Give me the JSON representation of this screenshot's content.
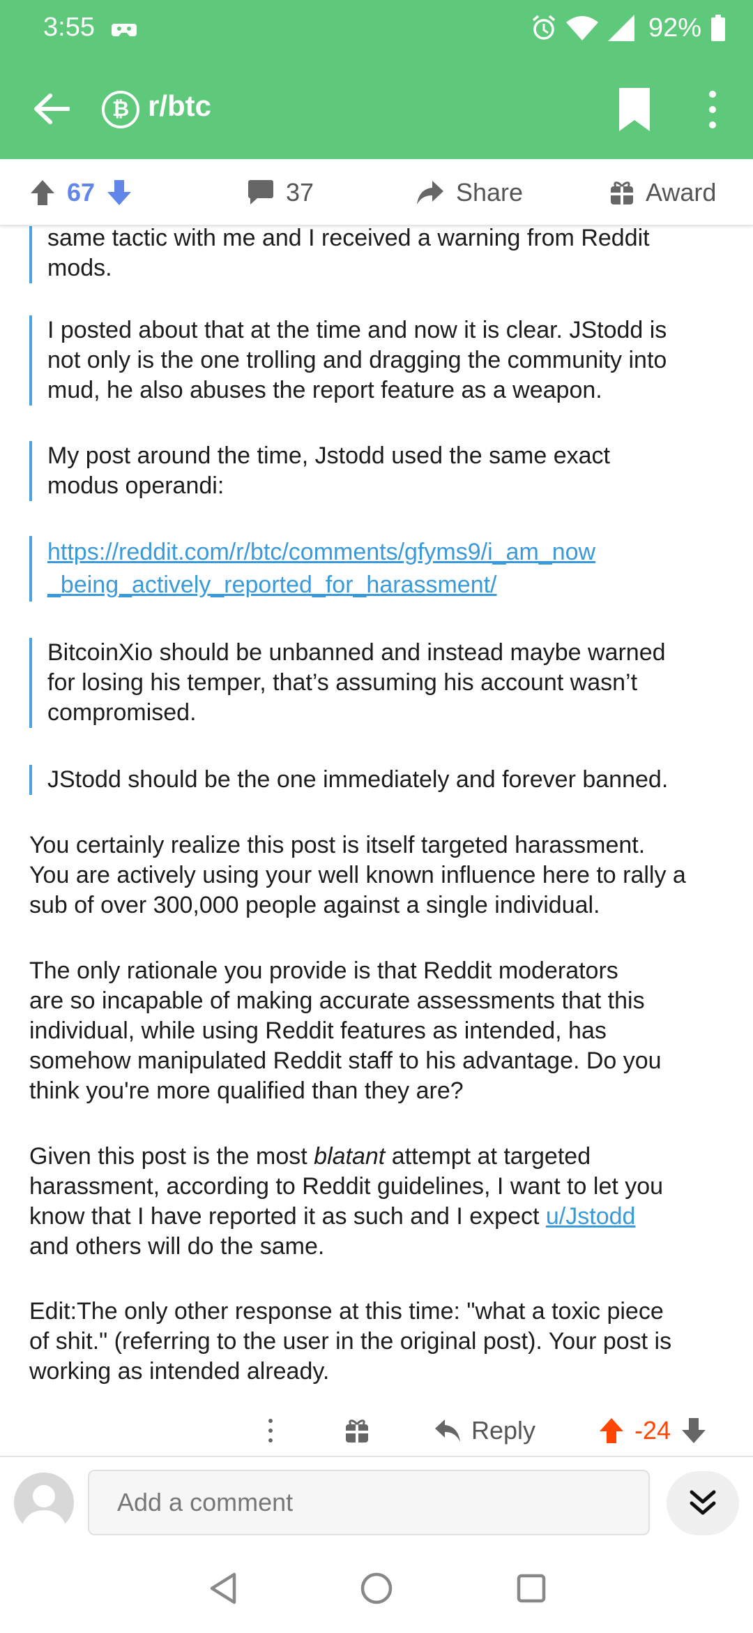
{
  "status_bar": {
    "time": "3:55",
    "battery": "92%"
  },
  "app_bar": {
    "subreddit": "r/btc",
    "sub_icon_glyph": "₿",
    "bg_color": "#5ec97a"
  },
  "post_actions": {
    "score": "67",
    "comments": "37",
    "share_label": "Share",
    "award_label": "Award"
  },
  "content": {
    "quote_fragment": {
      "line1": "same tactic with me and I received a warning from Reddit",
      "line2": "mods."
    },
    "quote_1": {
      "line1": "I posted about that at the time and now it is clear. JStodd is",
      "line2": "not only is the one trolling and dragging the community into",
      "line3": "mud, he also abuses the report feature as a weapon."
    },
    "quote_2": {
      "line1": "My post around the time, Jstodd used the same exact",
      "line2": "modus operandi:"
    },
    "quote_link": {
      "line1": "https://reddit.com/r/btc/comments/gfyms9/i_am_now",
      "line2": "_being_actively_reported_for_harassment/"
    },
    "quote_3": {
      "line1": "BitcoinXio should be unbanned and instead maybe warned",
      "line2": "for losing his temper, that’s assuming his account wasn’t",
      "line3": "compromised."
    },
    "quote_4": "JStodd should be the one immediately and forever banned.",
    "para_1": {
      "line1": "You certainly realize this post is itself targeted harassment.",
      "line2": "You are actively using your well known influence here to rally a",
      "line3": "sub of over 300,000 people against a single individual."
    },
    "para_2": {
      "line1": "The only rationale you provide is that Reddit moderators",
      "line2": "are so incapable of making accurate assessments that this",
      "line3": "individual,  while using Reddit features as intended, has",
      "line4": "somehow manipulated Reddit staff to his advantage. Do you",
      "line5": "think you're more qualified than they are?"
    },
    "para_3": {
      "pre": "Given this post is the most ",
      "em": "blatant",
      "post": " attempt at targeted",
      "line2": "harassment, according to Reddit guidelines, I want to let you",
      "line3_pre": "know that I have reported it as such and I expect ",
      "user_link": "u/Jstodd",
      "line4": "and others will do the same."
    },
    "para_4": {
      "line1": "Edit:The only other response at this time: \"what a toxic piece",
      "line2": "of shit.\" (referring to the user in the original post). Your post is",
      "line3": "working as intended already."
    }
  },
  "comment_actions": {
    "reply_label": "Reply",
    "score": "-24",
    "score_color": "#ff4500"
  },
  "composer": {
    "placeholder": "Add a comment"
  },
  "colors": {
    "link": "#3a9ad9",
    "quote_bar": "#4aa3df",
    "upvote_blue": "#5f86e8"
  }
}
